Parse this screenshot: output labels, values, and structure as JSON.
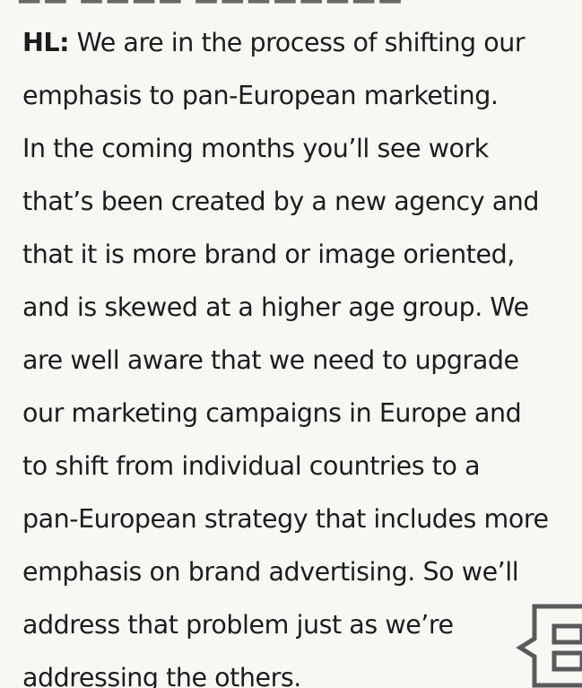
{
  "article": {
    "speaker": "HL:",
    "lines": [
      "We are in the process of shifting our",
      "emphasis to pan-European marketing.",
      "In the coming months you’ll see work",
      "that’s been created by a new agency and",
      "that it is more brand or image oriented,",
      "and is skewed at a higher age group. We",
      "are well aware that we need to upgrade",
      "our marketing campaigns in Europe and",
      "to shift from individual countries to a",
      "pan-European strategy that includes more",
      "emphasis on brand advertising. So we’ll",
      "address that problem just as we’re",
      "addressing the others."
    ]
  },
  "end_mark": {
    "icon": "end-of-article-icon",
    "color": "#5a5a5a"
  }
}
